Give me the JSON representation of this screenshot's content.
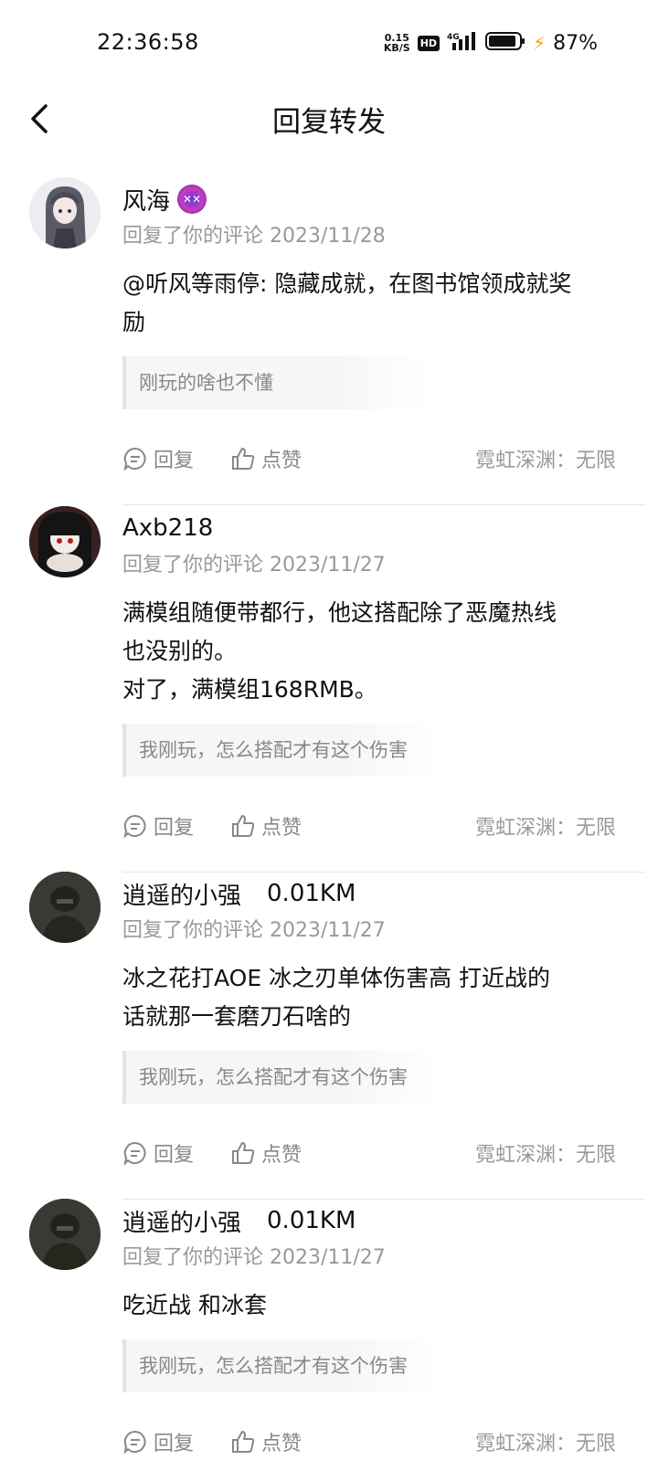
{
  "status_bar": {
    "time": "22:36:58",
    "speed_value": "0.15",
    "speed_unit": "KB/S",
    "hd": "HD",
    "network": "4G",
    "battery": "87%"
  },
  "header": {
    "title": "回复转发"
  },
  "actions": {
    "reply": "回复",
    "like": "点赞"
  },
  "items": [
    {
      "name": "风海",
      "distance": "",
      "meta": "回复了你的评论 2023/11/28",
      "text": "@听风等雨停: 隐藏成就，在图书馆领成就奖\n励",
      "quote": "刚玩的啥也不懂",
      "source": "霓虹深渊：无限"
    },
    {
      "name": "Axb218",
      "distance": "",
      "meta": "回复了你的评论 2023/11/27",
      "text": "满模组随便带都行，他这搭配除了恶魔热线\n也没别的。\n对了，满模组168RMB。",
      "quote": "我刚玩，怎么搭配才有这个伤害",
      "source": "霓虹深渊：无限"
    },
    {
      "name": "逍遥的小强",
      "distance": "0.01KM",
      "meta": "回复了你的评论 2023/11/27",
      "text": "冰之花打AOE  冰之刃单体伤害高  打近战的\n话就那一套磨刀石啥的",
      "quote": "我刚玩，怎么搭配才有这个伤害",
      "source": "霓虹深渊：无限"
    },
    {
      "name": "逍遥的小强",
      "distance": "0.01KM",
      "meta": "回复了你的评论 2023/11/27",
      "text": "吃近战 和冰套",
      "quote": "我刚玩，怎么搭配才有这个伤害",
      "source": "霓虹深渊：无限"
    }
  ]
}
